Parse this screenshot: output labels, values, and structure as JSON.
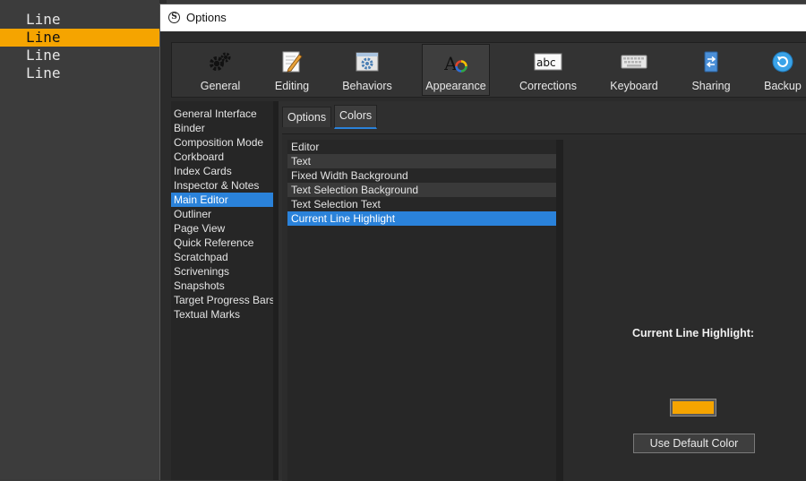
{
  "editor": {
    "lines": [
      "Line",
      "Line",
      "Line",
      "Line"
    ],
    "highlight_color": "#f5a400"
  },
  "window": {
    "title": "Options",
    "app_icon_letter": "S"
  },
  "toolbar": {
    "items": [
      {
        "label": "General",
        "icon": "gears-icon"
      },
      {
        "label": "Editing",
        "icon": "pencil-page-icon"
      },
      {
        "label": "Behaviors",
        "icon": "window-gear-icon"
      },
      {
        "label": "Appearance",
        "icon": "font-palette-icon",
        "selected": true
      },
      {
        "label": "Corrections",
        "icon": "abc-spelling-icon"
      },
      {
        "label": "Keyboard",
        "icon": "keyboard-icon"
      },
      {
        "label": "Sharing",
        "icon": "sync-arrows-icon"
      },
      {
        "label": "Backup",
        "icon": "backup-circle-icon"
      }
    ]
  },
  "categories": {
    "items": [
      "General Interface",
      "Binder",
      "Composition Mode",
      "Corkboard",
      "Index Cards",
      "Inspector & Notes",
      "Main Editor",
      "Outliner",
      "Page View",
      "Quick Reference",
      "Scratchpad",
      "Scrivenings",
      "Snapshots",
      "Target Progress Bars",
      "Textual Marks"
    ],
    "selected": "Main Editor"
  },
  "tabs": {
    "options": "Options",
    "colors": "Colors",
    "active": "Colors"
  },
  "color_items": {
    "items": [
      "Editor",
      "Text",
      "Fixed Width Background",
      "Text Selection Background",
      "Text Selection Text",
      "Current Line Highlight"
    ],
    "selected": "Current Line Highlight"
  },
  "detail": {
    "title": "Current Line Highlight:",
    "swatch_color": "#f5a400",
    "default_button": "Use Default Color"
  },
  "accent_color": "#2a82da"
}
